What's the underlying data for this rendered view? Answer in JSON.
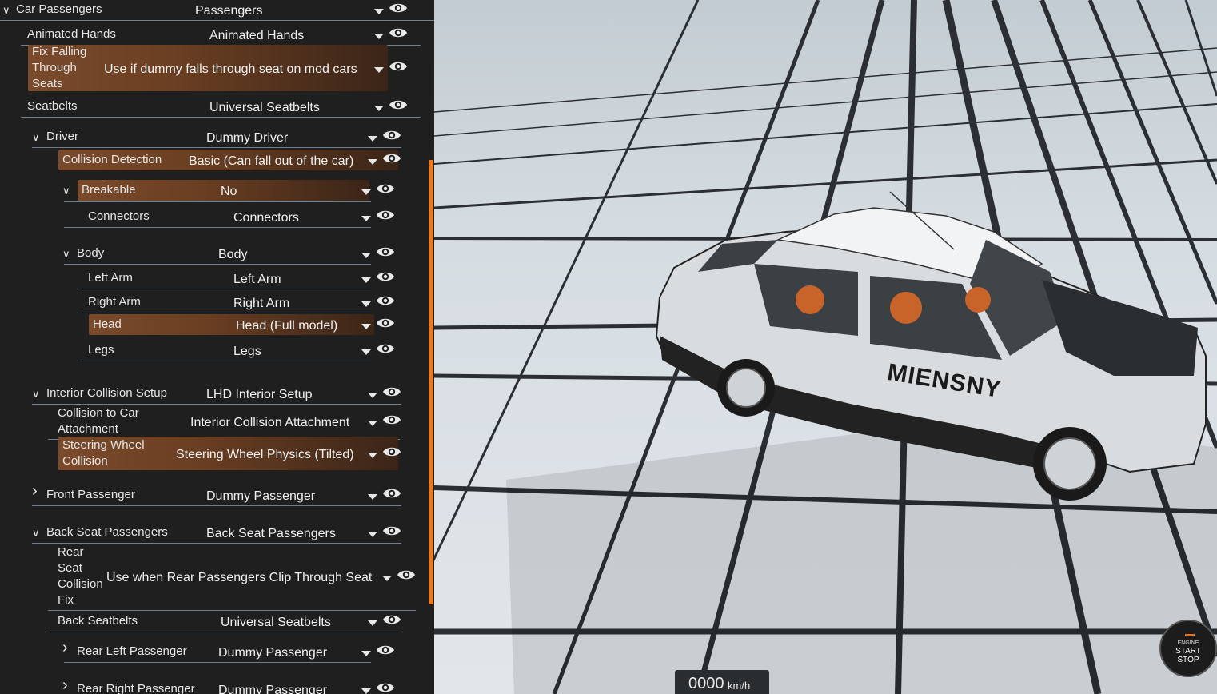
{
  "panel": {
    "rows": [
      {
        "id": "car-passengers",
        "label": [
          "Car Passengers"
        ],
        "value": "Passengers",
        "chevron": "down"
      },
      {
        "id": "animated-hands",
        "label": [
          "Animated Hands"
        ],
        "value": "Animated Hands"
      },
      {
        "id": "fix-falling",
        "label": [
          "Fix Falling",
          "Through",
          "Seats"
        ],
        "value": "Use if dummy falls through seat on mod cars",
        "highlight": true
      },
      {
        "id": "seatbelts",
        "label": [
          "Seatbelts"
        ],
        "value": "Universal Seatbelts"
      },
      {
        "id": "driver",
        "label": [
          "Driver"
        ],
        "value": "Dummy Driver",
        "chevron": "down"
      },
      {
        "id": "collision-detection",
        "label": [
          "Collision Detection"
        ],
        "value": "Basic (Can fall out of the car)",
        "highlight": true
      },
      {
        "id": "breakable",
        "label": [
          "Breakable"
        ],
        "value": "No",
        "chevron": "down",
        "highlight": true
      },
      {
        "id": "connectors",
        "label": [
          "Connectors"
        ],
        "value": "Connectors"
      },
      {
        "id": "body",
        "label": [
          "Body"
        ],
        "value": "Body",
        "chevron": "down"
      },
      {
        "id": "left-arm",
        "label": [
          "Left Arm"
        ],
        "value": "Left Arm"
      },
      {
        "id": "right-arm",
        "label": [
          "Right Arm"
        ],
        "value": "Right Arm"
      },
      {
        "id": "head",
        "label": [
          "Head"
        ],
        "value": "Head (Full model)",
        "highlight": true
      },
      {
        "id": "legs",
        "label": [
          "Legs"
        ],
        "value": "Legs"
      },
      {
        "id": "interior-collision-setup",
        "label": [
          "Interior Collision Setup"
        ],
        "value": "LHD Interior Setup",
        "chevron": "down"
      },
      {
        "id": "collision-to-car",
        "label": [
          "Collision to Car",
          "Attachment"
        ],
        "value": "Interior Collision Attachment"
      },
      {
        "id": "steering-wheel-collision",
        "label": [
          "Steering Wheel",
          "Collision"
        ],
        "value": "Steering Wheel Physics (Tilted)",
        "highlight": true
      },
      {
        "id": "front-passenger",
        "label": [
          "Front Passenger"
        ],
        "value": "Dummy Passenger",
        "chevron": "right"
      },
      {
        "id": "back-seat-passengers",
        "label": [
          "Back Seat Passengers"
        ],
        "value": "Back Seat Passengers",
        "chevron": "down"
      },
      {
        "id": "rear-seat-collision-fix",
        "label": [
          "Rear",
          "Seat",
          "Collision",
          "Fix"
        ],
        "value": "Use when Rear Passengers Clip Through Seat"
      },
      {
        "id": "back-seatbelts",
        "label": [
          "Back Seatbelts"
        ],
        "value": "Universal Seatbelts"
      },
      {
        "id": "rear-left-passenger",
        "label": [
          "Rear Left Passenger"
        ],
        "value": "Dummy Passenger",
        "chevron": "right"
      },
      {
        "id": "rear-right-passenger",
        "label": [
          "Rear Right Passenger"
        ],
        "value": "Dummy Passenger",
        "chevron": "right"
      }
    ]
  },
  "car": {
    "plate_text": "MIENSNY"
  },
  "speedometer": {
    "value": "0000",
    "unit": "km/h"
  },
  "engine_button": {
    "line1": "ENGINE",
    "line2": "START",
    "line3": "STOP"
  },
  "icons": {
    "eye": "eye-icon",
    "caret": "caret-down-icon",
    "chevron_down": "chevron-down-icon",
    "chevron_right": "chevron-right-icon"
  },
  "colors": {
    "accent": "#e57b25",
    "highlight": "#7a4a2b",
    "panel_bg": "#1f1f1f",
    "underline": "#6f7f90"
  }
}
